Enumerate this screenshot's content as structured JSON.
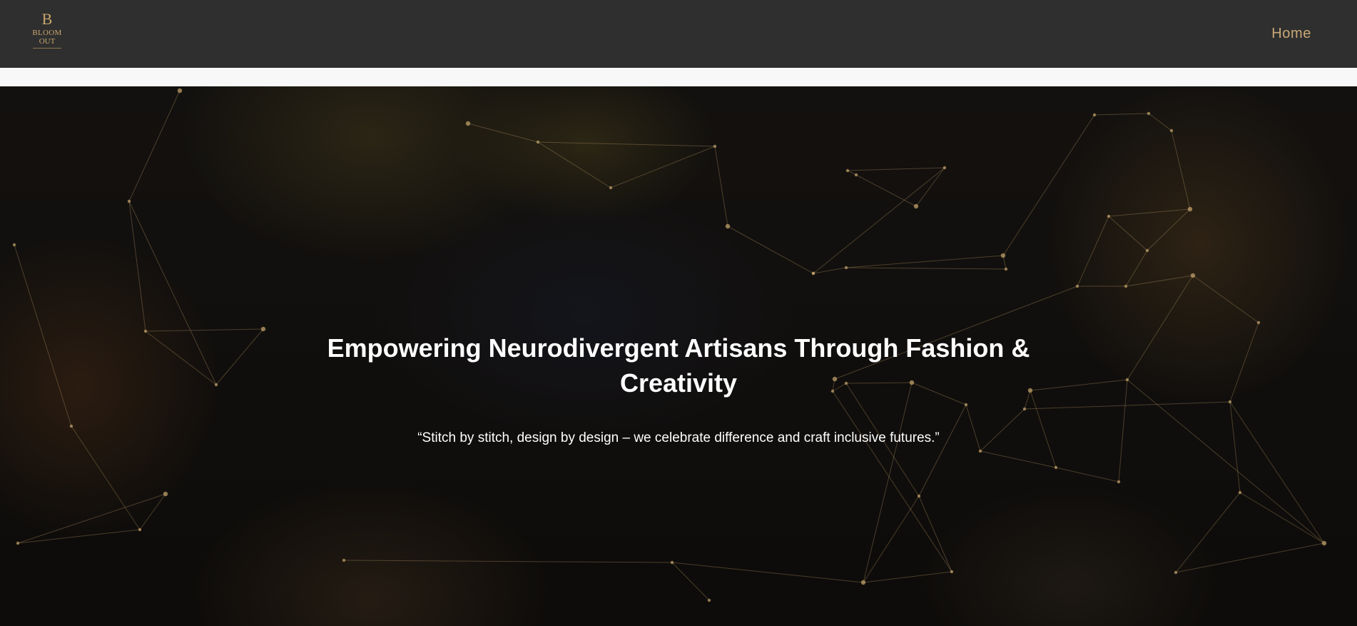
{
  "brand": {
    "logo_mark": "B",
    "logo_line1": "BLOOM",
    "logo_line2": "OUT",
    "accent_color": "#c9a876"
  },
  "nav": {
    "home_label": "Home"
  },
  "hero": {
    "title": "Empowering Neurodivergent Artisans Through Fashion & Creativity",
    "quote": "“Stitch by stitch, design by design – we celebrate difference and craft inclusive futures.”",
    "overlay_color": "#000000",
    "network_color": "#c8a66e"
  }
}
